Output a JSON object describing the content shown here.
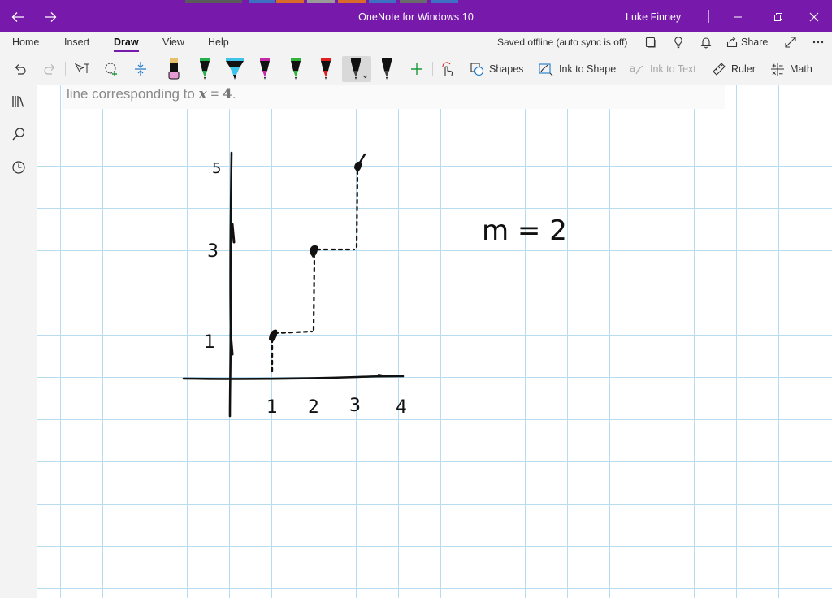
{
  "window": {
    "title": "OneNote for Windows 10",
    "user": "Luke Finney"
  },
  "menu": {
    "tabs": [
      "Home",
      "Insert",
      "Draw",
      "View",
      "Help"
    ],
    "active_tab": "Draw",
    "sync_status": "Saved offline (auto sync is off)",
    "share_label": "Share"
  },
  "toolbar": {
    "shapes_label": "Shapes",
    "ink_to_shape_label": "Ink to Shape",
    "ink_to_text_label": "Ink to Text",
    "ruler_label": "Ruler",
    "math_label": "Math",
    "pens": [
      {
        "name": "highlighter-pink",
        "color": "#e59bd6"
      },
      {
        "name": "pen-green",
        "color": "#23b14d"
      },
      {
        "name": "highlighter-cyan",
        "color": "#3fc3e8"
      },
      {
        "name": "pen-magenta",
        "color": "#c42aa8"
      },
      {
        "name": "pen-green-2",
        "color": "#2fb53a"
      },
      {
        "name": "pen-red",
        "color": "#e02020"
      },
      {
        "name": "pen-black",
        "color": "#111111"
      },
      {
        "name": "pen-black-2",
        "color": "#111111"
      }
    ]
  },
  "page": {
    "text_prefix": "line corresponding to ",
    "text_var": "x",
    "text_eq": " = ",
    "text_num": "4",
    "text_suffix": "."
  },
  "ink": {
    "y_label_1": "1",
    "y_label_3": "3",
    "y_label_5": "5",
    "x_label_1": "1",
    "x_label_2": "2",
    "x_label_3": "3",
    "x_label_4": "4",
    "equation": "m = 2"
  },
  "colors": {
    "accent": "#7719aa",
    "grid": "#b7dcef",
    "chrome": "#f3f3f3"
  }
}
